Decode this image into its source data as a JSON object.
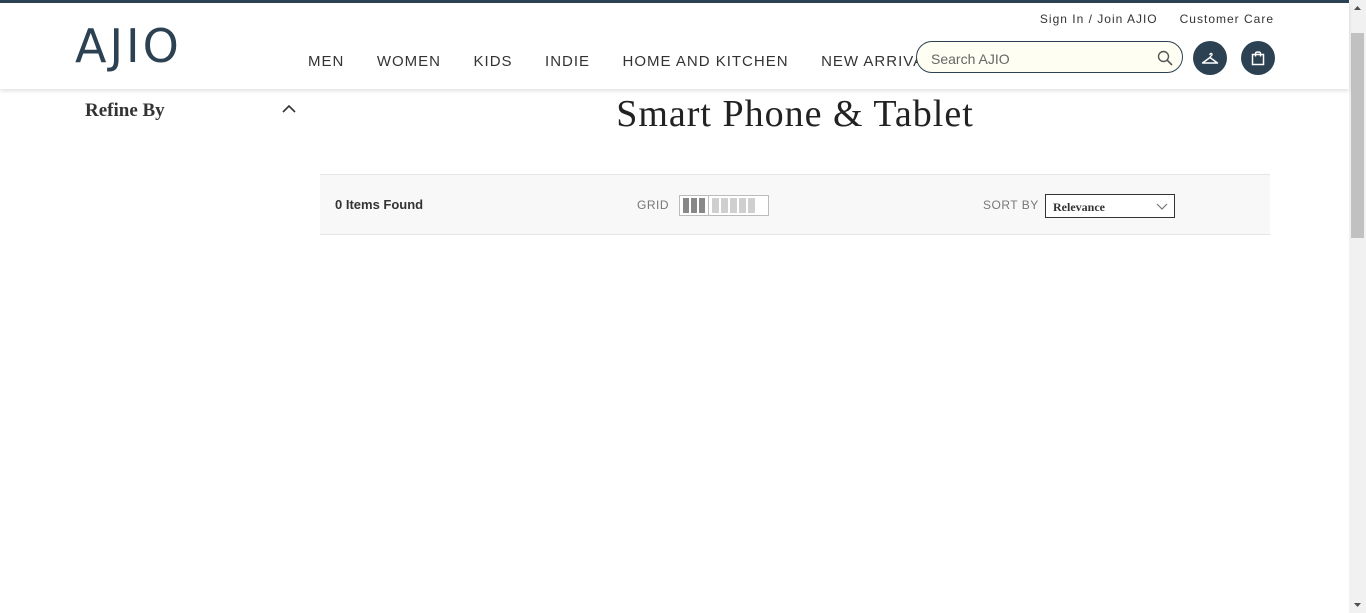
{
  "header": {
    "logo": "AJIO",
    "top_links": [
      "Sign In / Join AJIO",
      "Customer Care"
    ],
    "nav": [
      "MEN",
      "WOMEN",
      "KIDS",
      "INDIE",
      "HOME AND KITCHEN",
      "NEW ARRIVALS"
    ],
    "search_placeholder": "Search AJIO",
    "brand_color": "#2c4152"
  },
  "sidebar": {
    "title": "Refine By"
  },
  "main": {
    "title": "Smart Phone & Tablet",
    "items_found": "0 Items Found",
    "grid_label": "GRID",
    "sort_label": "SORT BY",
    "sort_value": "Relevance"
  }
}
